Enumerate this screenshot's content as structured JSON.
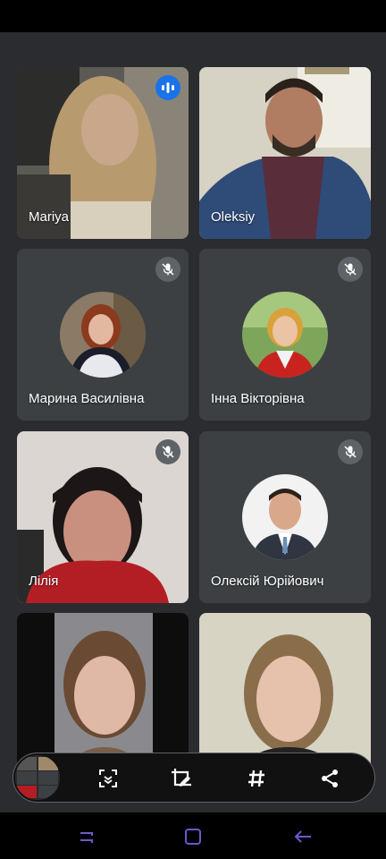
{
  "participants": [
    {
      "name": "Mariya",
      "status": "speaking",
      "icon": "audio-wave-icon"
    },
    {
      "name": "Oleksiy",
      "status": "video"
    },
    {
      "name": "Марина Василівна",
      "status": "muted",
      "icon": "mic-off-icon"
    },
    {
      "name": "Інна Вікторівна",
      "status": "muted",
      "icon": "mic-off-icon"
    },
    {
      "name": "Лілія",
      "status": "muted",
      "icon": "mic-off-icon"
    },
    {
      "name": "Олексій Юрійович",
      "status": "muted",
      "icon": "mic-off-icon"
    },
    {
      "name": "",
      "status": "video"
    },
    {
      "name": "",
      "status": "video"
    }
  ],
  "toolbar": {
    "items": [
      {
        "name": "participants-thumbnail",
        "icon": "grid-thumbnail-icon"
      },
      {
        "name": "focus-button",
        "icon": "focus-frame-icon"
      },
      {
        "name": "crop-edit-button",
        "icon": "crop-edit-icon"
      },
      {
        "name": "tag-button",
        "icon": "hashtag-icon"
      },
      {
        "name": "share-button",
        "icon": "share-icon"
      }
    ]
  },
  "navigation": {
    "items": [
      {
        "name": "recent-apps",
        "icon": "recent-apps-icon"
      },
      {
        "name": "home",
        "icon": "home-icon"
      },
      {
        "name": "back",
        "icon": "back-arrow-icon"
      }
    ]
  },
  "colors": {
    "background": "#2b2c30",
    "tile": "#3c4043",
    "speaking": "#1a73e8",
    "nav_icons": "#6a5acd"
  }
}
